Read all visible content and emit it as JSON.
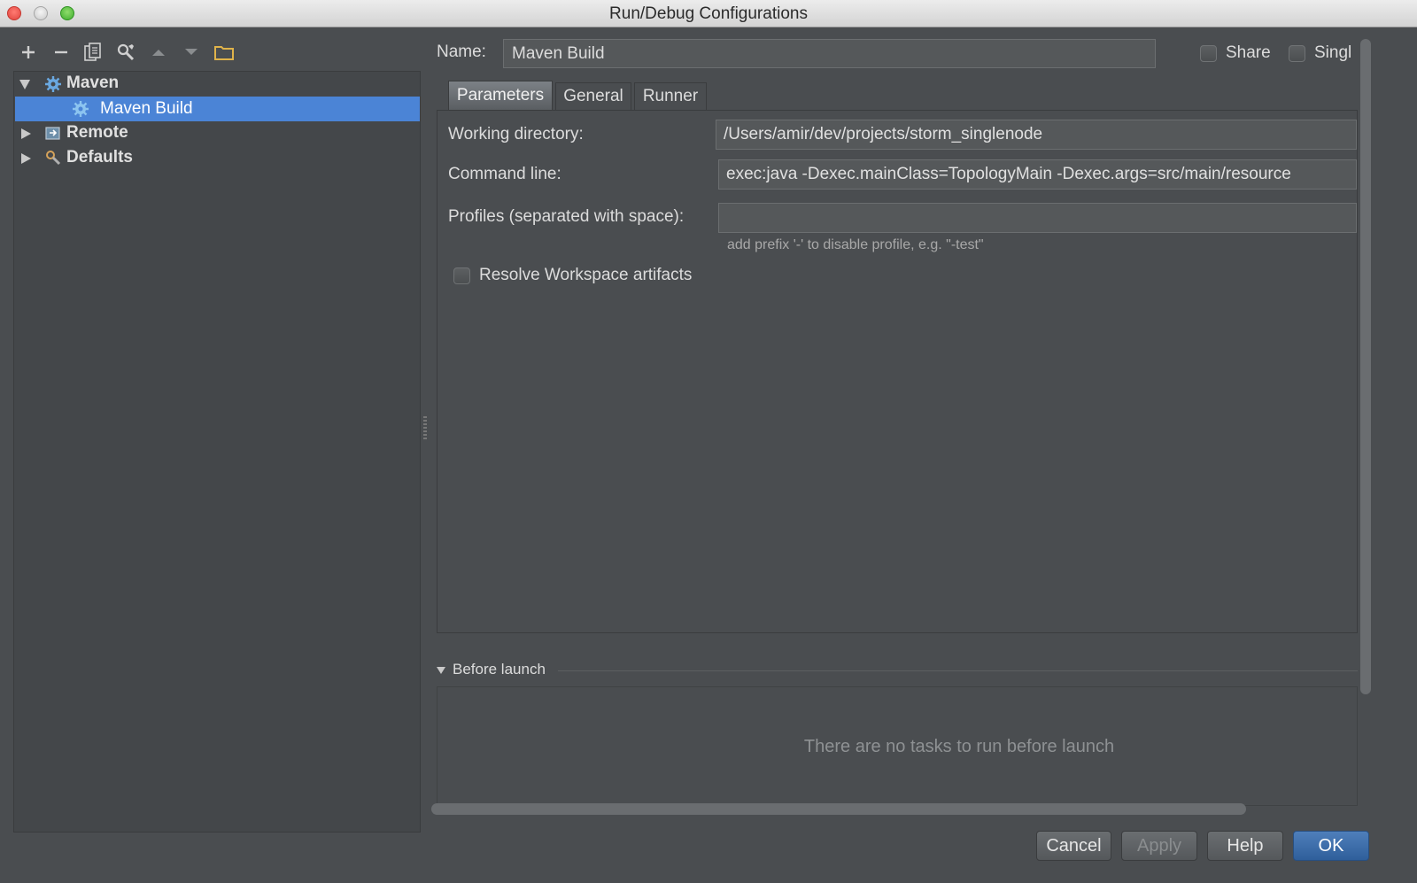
{
  "window": {
    "title": "Run/Debug Configurations"
  },
  "tree": {
    "items": [
      {
        "label": "Maven",
        "expanded": true,
        "icon": "maven-gear-icon"
      },
      {
        "label": "Maven Build",
        "selected": true,
        "icon": "gear-icon"
      },
      {
        "label": "Remote",
        "expanded": false,
        "icon": "remote-icon"
      },
      {
        "label": "Defaults",
        "expanded": false,
        "icon": "wrench-icon"
      }
    ]
  },
  "toolbar": {
    "buttons": [
      "add-icon",
      "remove-icon",
      "copy-icon",
      "wrench-icon",
      "move-up-icon",
      "move-down-icon",
      "folder-icon"
    ]
  },
  "config": {
    "name_label": "Name:",
    "name_value": "Maven Build",
    "share_label": "Share",
    "single_label": "Singl"
  },
  "tabs": [
    "Parameters",
    "General",
    "Runner"
  ],
  "parameters": {
    "working_dir_label": "Working directory:",
    "working_dir_value": "/Users/amir/dev/projects/storm_singlenode",
    "command_label": "Command line:",
    "command_value": "exec:java -Dexec.mainClass=TopologyMain -Dexec.args=src/main/resource",
    "profiles_label": "Profiles (separated with space):",
    "profiles_value": "",
    "profiles_hint": "add prefix '-' to disable profile, e.g. \"-test\"",
    "resolve_label": "Resolve Workspace artifacts"
  },
  "before_launch": {
    "title": "Before launch",
    "empty_text": "There are no tasks to run before launch"
  },
  "buttons": {
    "cancel": "Cancel",
    "apply": "Apply",
    "help": "Help",
    "ok": "OK"
  },
  "colors": {
    "selection": "#4b84d6",
    "background": "#4a4d50",
    "ok_button": "#3b6ba8"
  }
}
